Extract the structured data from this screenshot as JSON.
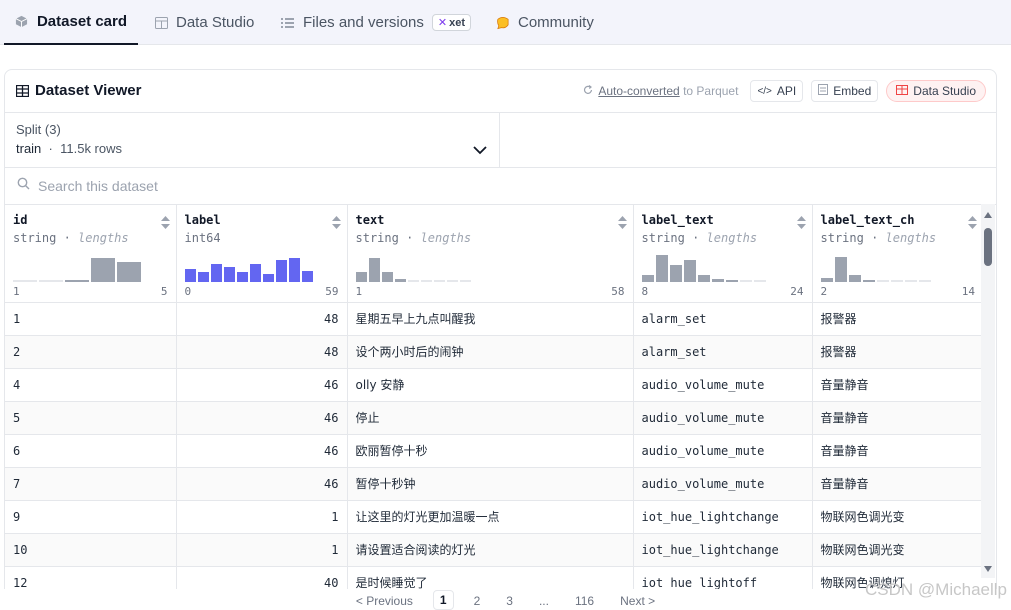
{
  "tabs": [
    {
      "label": "Dataset card",
      "icon": "cube-icon",
      "active": true
    },
    {
      "label": "Data Studio",
      "icon": "table-icon"
    },
    {
      "label": "Files and versions",
      "icon": "files-icon",
      "badge": "xet"
    },
    {
      "label": "Community",
      "icon": "community-icon"
    }
  ],
  "viewer": {
    "title": "Dataset Viewer",
    "auto_converted_link": "Auto-converted",
    "auto_converted_suffix": "to Parquet",
    "api_label": "API",
    "embed_label": "Embed",
    "studio_label": "Data Studio"
  },
  "split": {
    "label": "Split (3)",
    "name": "train",
    "separator": "·",
    "rows": "11.5k rows"
  },
  "search": {
    "placeholder": "Search this dataset"
  },
  "columns": [
    {
      "name": "id",
      "type": "string",
      "stat": "lengths",
      "min": "1",
      "max": "5",
      "hist": [
        0.05,
        0.05,
        0.08,
        0.85,
        0.7
      ],
      "color": "gray"
    },
    {
      "name": "label",
      "type": "int64",
      "stat": "",
      "min": "0",
      "max": "59",
      "hist": [
        0.45,
        0.35,
        0.65,
        0.55,
        0.35,
        0.65,
        0.3,
        0.8,
        0.85,
        0.4
      ],
      "color": "blue"
    },
    {
      "name": "text",
      "type": "string",
      "stat": "lengths",
      "min": "1",
      "max": "58",
      "hist": [
        0.35,
        0.85,
        0.35,
        0.1,
        0.05,
        0.05,
        0.05,
        0.05,
        0.05
      ],
      "color": "gray"
    },
    {
      "name": "label_text",
      "type": "string",
      "stat": "lengths",
      "min": "8",
      "max": "24",
      "hist": [
        0.25,
        0.95,
        0.6,
        0.8,
        0.25,
        0.12,
        0.08,
        0.05,
        0.05
      ],
      "color": "gray"
    },
    {
      "name": "label_text_ch",
      "type": "string",
      "stat": "lengths",
      "min": "2",
      "max": "14",
      "hist": [
        0.15,
        0.9,
        0.25,
        0.08,
        0.05,
        0.05,
        0.05,
        0.05
      ],
      "color": "gray"
    }
  ],
  "rows": [
    {
      "id": "1",
      "label": "48",
      "text": "星期五早上九点叫醒我",
      "label_text": "alarm_set",
      "label_text_ch": "报警器"
    },
    {
      "id": "2",
      "label": "48",
      "text": "设个两小时后的闹钟",
      "label_text": "alarm_set",
      "label_text_ch": "报警器"
    },
    {
      "id": "4",
      "label": "46",
      "text": "olly 安静",
      "label_text": "audio_volume_mute",
      "label_text_ch": "音量静音"
    },
    {
      "id": "5",
      "label": "46",
      "text": "停止",
      "label_text": "audio_volume_mute",
      "label_text_ch": "音量静音"
    },
    {
      "id": "6",
      "label": "46",
      "text": "欧丽暂停十秒",
      "label_text": "audio_volume_mute",
      "label_text_ch": "音量静音"
    },
    {
      "id": "7",
      "label": "46",
      "text": "暂停十秒钟",
      "label_text": "audio_volume_mute",
      "label_text_ch": "音量静音"
    },
    {
      "id": "9",
      "label": "1",
      "text": "让这里的灯光更加温暖一点",
      "label_text": "iot_hue_lightchange",
      "label_text_ch": "物联网色调光变"
    },
    {
      "id": "10",
      "label": "1",
      "text": "请设置适合阅读的灯光",
      "label_text": "iot_hue_lightchange",
      "label_text_ch": "物联网色调光变"
    },
    {
      "id": "12",
      "label": "40",
      "text": "是时候睡觉了",
      "label_text": "iot_hue_lightoff",
      "label_text_ch": "物联网色调熄灯"
    }
  ],
  "pagination": {
    "previous": "< Previous",
    "pages": [
      "1",
      "2",
      "3",
      "...",
      "116"
    ],
    "current": "1",
    "next": "Next >"
  },
  "watermark": "CSDN @Michaellp"
}
